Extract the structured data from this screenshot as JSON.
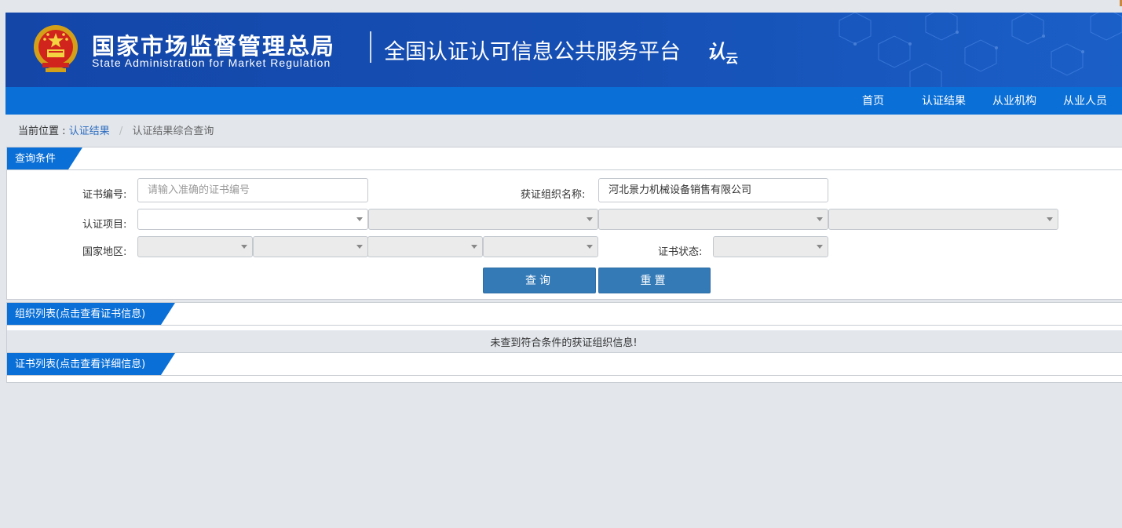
{
  "header": {
    "org_name_cn": "国家市场监督管理总局",
    "org_name_en": "State Administration  for  Market Regulation",
    "platform_title": "全国认证认可信息公共服务平台",
    "logo_text": "认",
    "logo_sub": "云"
  },
  "nav": {
    "items": [
      "首页",
      "认证结果",
      "从业机构",
      "从业人员"
    ]
  },
  "breadcrumb": {
    "prefix": "当前位置 :",
    "link": "认证结果",
    "separator": "/",
    "current": "认证结果综合查询"
  },
  "query_panel": {
    "title": "查询条件",
    "cert_no_label": "证书编号:",
    "cert_no_placeholder": "请输入准确的证书编号",
    "org_name_label": "获证组织名称:",
    "org_name_value": "河北景力机械设备销售有限公司",
    "cert_item_label": "认证项目:",
    "region_label": "国家地区:",
    "status_label": "证书状态:",
    "search_button": "查询",
    "reset_button": "重置"
  },
  "org_list": {
    "title": "组织列表(点击查看证书信息)",
    "empty_message": "未查到符合条件的获证组织信息!"
  },
  "cert_list": {
    "title": "证书列表(点击查看详细信息)"
  },
  "colors": {
    "banner": "#1446a8",
    "nav": "#0a6fd6",
    "button": "#337ab7",
    "link": "#2b6bbf"
  }
}
